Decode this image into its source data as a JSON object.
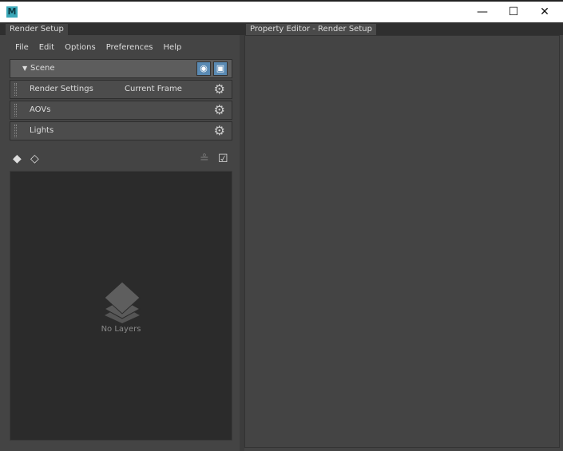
{
  "window": {
    "logo": "M",
    "minimize": "—",
    "maximize": "☐",
    "close": "✕"
  },
  "left_panel": {
    "tab": "Render Setup",
    "menu": [
      "File",
      "Edit",
      "Options",
      "Preferences",
      "Help"
    ],
    "scene": {
      "label": "Scene"
    },
    "rows": [
      {
        "label": "Render Settings",
        "value": "Current Frame"
      },
      {
        "label": "AOVs",
        "value": ""
      },
      {
        "label": "Lights",
        "value": ""
      }
    ],
    "empty_text": "No Layers"
  },
  "right_panel": {
    "tab": "Property Editor - Render Setup"
  }
}
